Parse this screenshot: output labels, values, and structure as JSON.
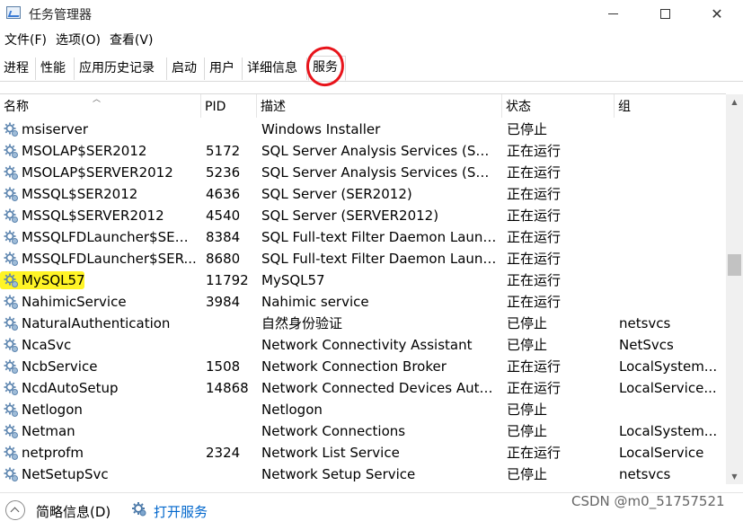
{
  "window": {
    "title": "任务管理器",
    "controls": {
      "minimize": "",
      "maximize": "",
      "close": "✕"
    }
  },
  "menu": [
    "文件(F)",
    "选项(O)",
    "查看(V)"
  ],
  "tabs": [
    "进程",
    "性能",
    "应用历史记录",
    "启动",
    "用户",
    "详细信息",
    "服务"
  ],
  "active_tab": "服务",
  "table": {
    "columns": [
      "名称",
      "PID",
      "描述",
      "状态",
      "组"
    ],
    "rows": [
      {
        "name": "msiserver",
        "pid": "",
        "desc": "Windows Installer",
        "status": "已停止",
        "group": ""
      },
      {
        "name": "MSOLAP$SER2012",
        "pid": "5172",
        "desc": "SQL Server Analysis Services (SER...",
        "status": "正在运行",
        "group": ""
      },
      {
        "name": "MSOLAP$SERVER2012",
        "pid": "5236",
        "desc": "SQL Server Analysis Services (SER...",
        "status": "正在运行",
        "group": ""
      },
      {
        "name": "MSSQL$SER2012",
        "pid": "4636",
        "desc": "SQL Server (SER2012)",
        "status": "正在运行",
        "group": ""
      },
      {
        "name": "MSSQL$SERVER2012",
        "pid": "4540",
        "desc": "SQL Server (SERVER2012)",
        "status": "正在运行",
        "group": ""
      },
      {
        "name": "MSSQLFDLauncher$SER2...",
        "pid": "8384",
        "desc": "SQL Full-text Filter Daemon Launc...",
        "status": "正在运行",
        "group": ""
      },
      {
        "name": "MSSQLFDLauncher$SER...",
        "pid": "8680",
        "desc": "SQL Full-text Filter Daemon Launc...",
        "status": "正在运行",
        "group": ""
      },
      {
        "name": "MySQL57",
        "pid": "11792",
        "desc": "MySQL57",
        "status": "正在运行",
        "group": "",
        "highlighted": true
      },
      {
        "name": "NahimicService",
        "pid": "3984",
        "desc": "Nahimic service",
        "status": "正在运行",
        "group": ""
      },
      {
        "name": "NaturalAuthentication",
        "pid": "",
        "desc": "自然身份验证",
        "status": "已停止",
        "group": "netsvcs"
      },
      {
        "name": "NcaSvc",
        "pid": "",
        "desc": "Network Connectivity Assistant",
        "status": "已停止",
        "group": "NetSvcs"
      },
      {
        "name": "NcbService",
        "pid": "1508",
        "desc": "Network Connection Broker",
        "status": "正在运行",
        "group": "LocalSystem..."
      },
      {
        "name": "NcdAutoSetup",
        "pid": "14868",
        "desc": "Network Connected Devices Auto...",
        "status": "正在运行",
        "group": "LocalService..."
      },
      {
        "name": "Netlogon",
        "pid": "",
        "desc": "Netlogon",
        "status": "已停止",
        "group": ""
      },
      {
        "name": "Netman",
        "pid": "",
        "desc": "Network Connections",
        "status": "已停止",
        "group": "LocalSystem..."
      },
      {
        "name": "netprofm",
        "pid": "2324",
        "desc": "Network List Service",
        "status": "正在运行",
        "group": "LocalService"
      },
      {
        "name": "NetSetupSvc",
        "pid": "",
        "desc": "Network Setup Service",
        "status": "已停止",
        "group": "netsvcs"
      }
    ]
  },
  "footer": {
    "collapse_label": "简略信息(D)",
    "open_services_label": "打开服务",
    "watermark": "CSDN @m0_51757521"
  },
  "colors": {
    "highlight": "#fff200",
    "annotation_circle": "#e8141b",
    "link": "#0066cc"
  },
  "icons": {
    "service": "gear-icon",
    "open_services": "gear-icon",
    "collapse": "chevron-up-icon",
    "app": "task-manager-icon"
  }
}
